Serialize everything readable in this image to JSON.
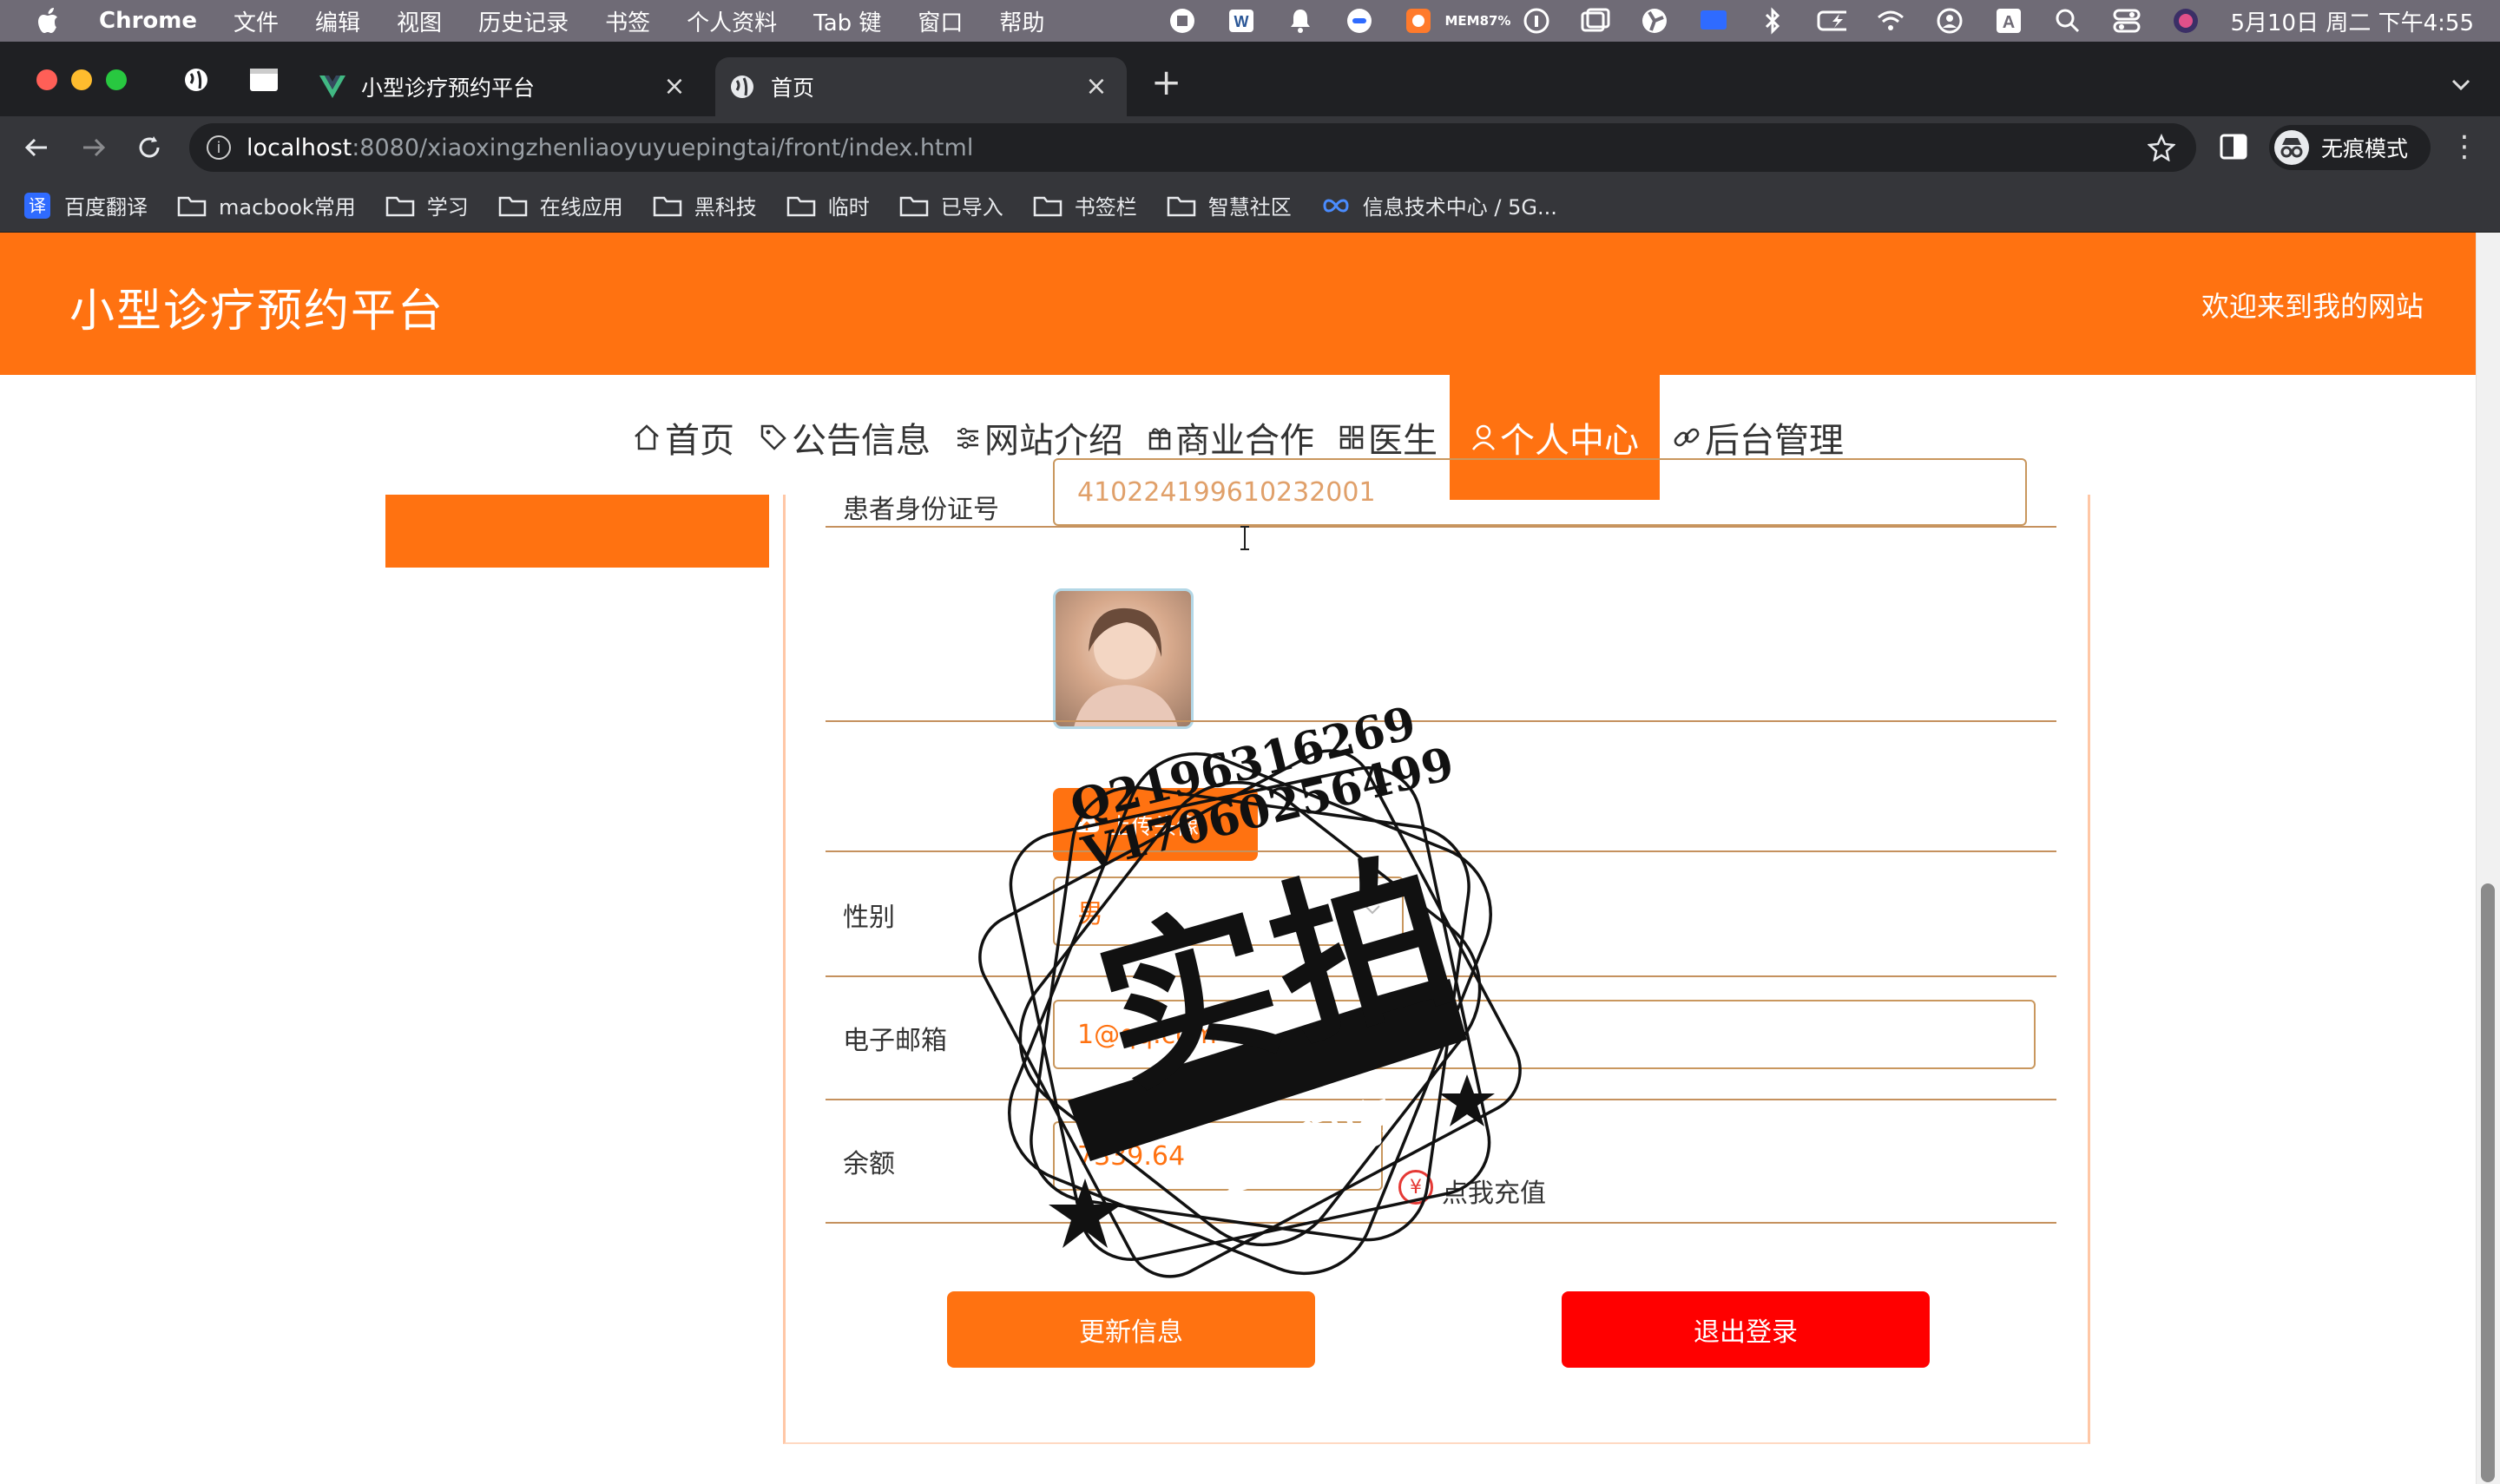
{
  "menubar": {
    "app_name": "Chrome",
    "items": [
      "文件",
      "编辑",
      "视图",
      "历史记录",
      "书签",
      "个人资料",
      "Tab 键",
      "窗口",
      "帮助"
    ],
    "mem_label": "MEM",
    "mem_value": "87%",
    "clock": "5月10日 周二 下午4:55"
  },
  "tabs": [
    {
      "title": "小型诊疗预约平台",
      "active": false
    },
    {
      "title": "首页",
      "active": true
    }
  ],
  "toolbar": {
    "url_host": "localhost",
    "url_rest": ":8080/xiaoxingzhenliaoyuyuepingtai/front/index.html",
    "incognito_label": "无痕模式"
  },
  "bookmarks": [
    "百度翻译",
    "macbook常用",
    "学习",
    "在线应用",
    "黑科技",
    "临时",
    "已导入",
    "书签栏",
    "智慧社区",
    "信息技术中心 / 5G..."
  ],
  "header": {
    "site_title": "小型诊疗预约平台",
    "welcome": "欢迎来到我的网站"
  },
  "nav": [
    {
      "label": "首页",
      "icon": "home-icon",
      "active": false
    },
    {
      "label": "公告信息",
      "icon": "tag-icon",
      "active": false
    },
    {
      "label": "网站介绍",
      "icon": "sliders-icon",
      "active": false
    },
    {
      "label": "商业合作",
      "icon": "gift-icon",
      "active": false
    },
    {
      "label": "医生",
      "icon": "grid-icon",
      "active": false
    },
    {
      "label": "个人中心",
      "icon": "user-icon",
      "active": true
    },
    {
      "label": "后台管理",
      "icon": "link-icon",
      "active": false
    }
  ],
  "form": {
    "id_label": "患者身份证号",
    "id_value": "410224199610232001",
    "upload_label": "上传头像",
    "gender_label": "性别",
    "gender_value": "男",
    "email_label": "电子邮箱",
    "email_value": "1@qq.com",
    "balance_label": "余额",
    "balance_value": "7339.64",
    "recharge_label": "点我充值",
    "update_button": "更新信息",
    "logout_button": "退出登录"
  },
  "watermark": {
    "line1": "Q2196316269",
    "line2": "V17060256499",
    "big": "实拍",
    "ribbon": "全微程序"
  },
  "colors": {
    "brand": "#ff7211",
    "danger": "#ff0000",
    "field_border": "#c9975e"
  }
}
